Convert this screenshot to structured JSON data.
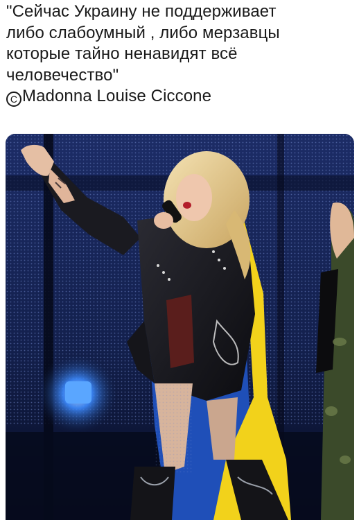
{
  "caption": {
    "lines": [
      "\"Сейчас Украину не поддерживает",
      "либо слабоумный , либо мерзавцы",
      "которые тайно ненавидят всё",
      "человечество\""
    ],
    "attribution_symbol": "C",
    "attribution_name": "Madonna Louise Ciccone"
  },
  "photo": {
    "subject": "performer-with-microphone",
    "flag_colors": [
      "#1f4fb8",
      "#f2d21b"
    ],
    "stage_light_color": "#2a7bff"
  }
}
